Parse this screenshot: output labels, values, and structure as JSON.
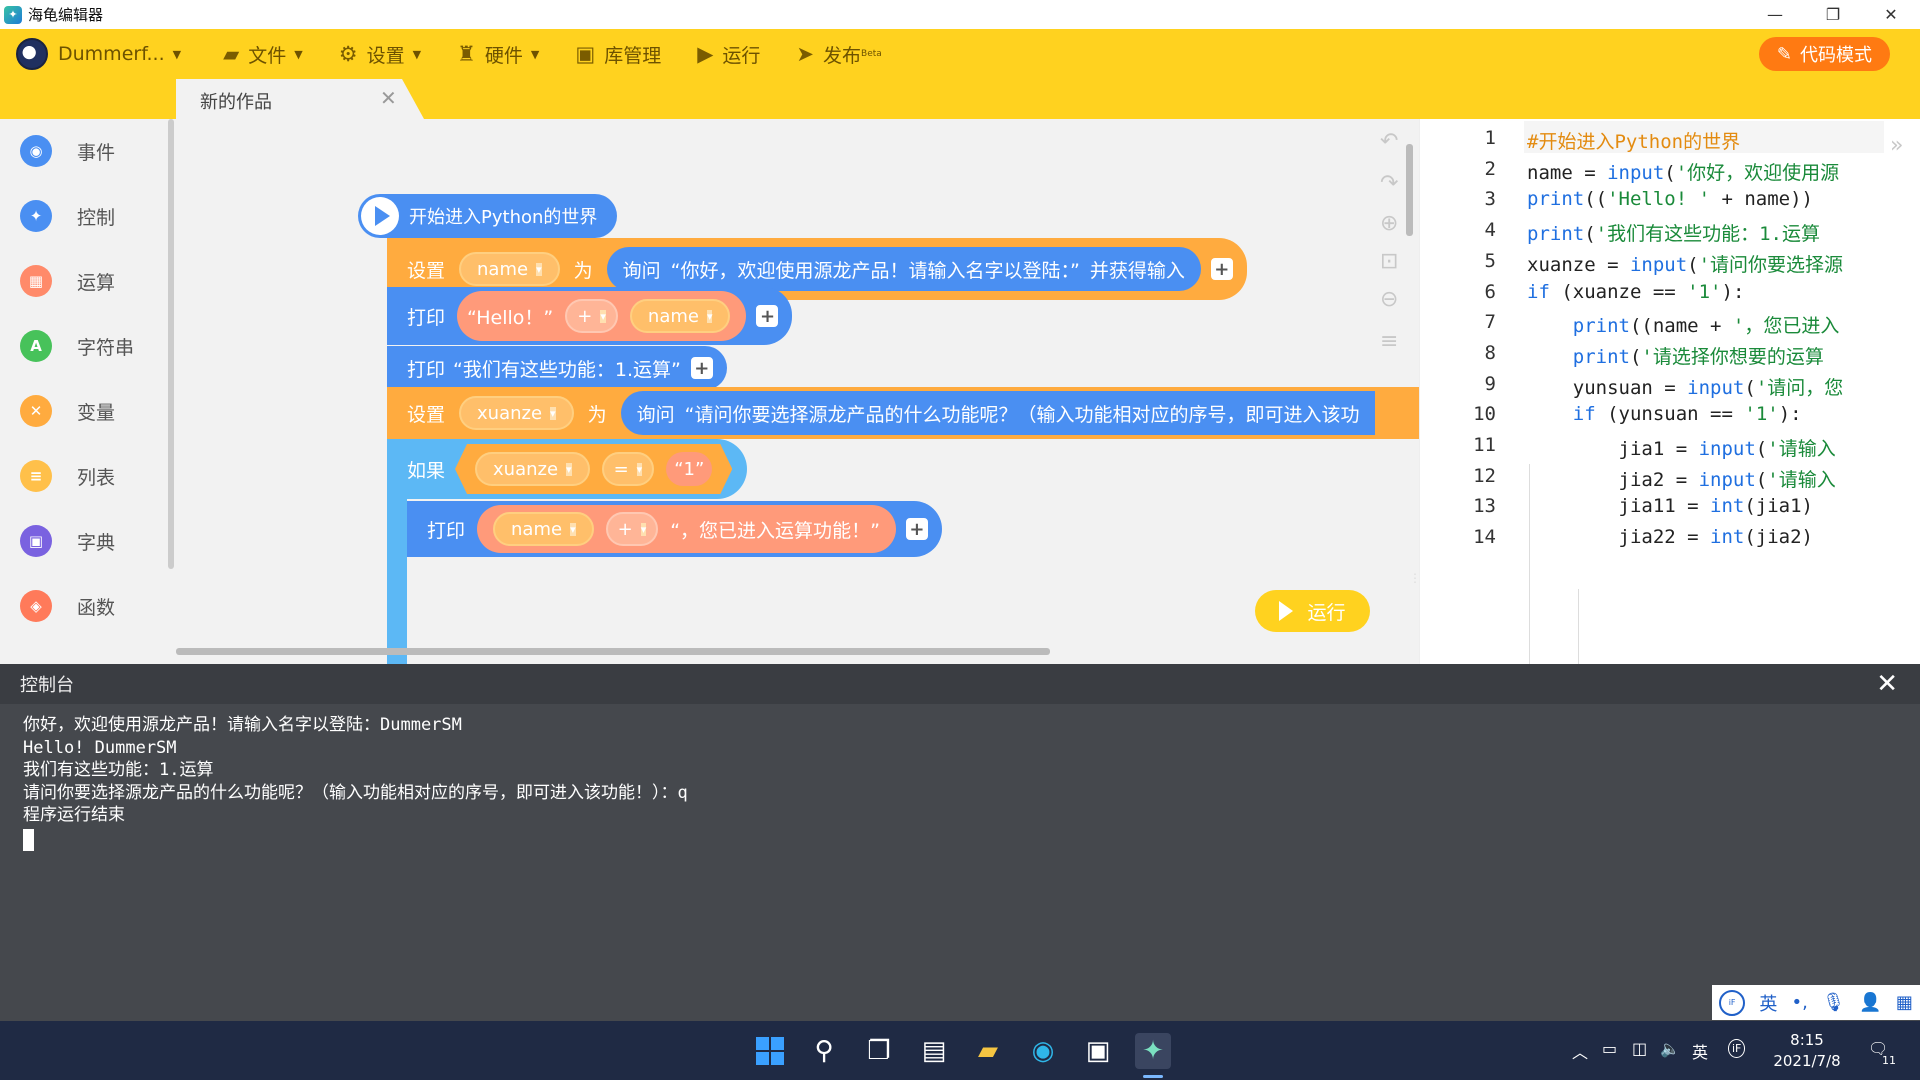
{
  "window": {
    "title": "海龟编辑器",
    "min": "—",
    "max": "❐",
    "close": "✕"
  },
  "toolbar": {
    "user": "Dummerf...",
    "file": "文件",
    "settings": "设置",
    "hardware": "硬件",
    "library": "库管理",
    "run": "运行",
    "publish": "发布",
    "publish_badge": "Beta",
    "code_mode": "代码模式"
  },
  "tab": {
    "label": "新的作品",
    "close": "✕"
  },
  "sidebar": {
    "items": [
      {
        "label": "事件",
        "color": "#4a8ff2",
        "glyph": "◉"
      },
      {
        "label": "控制",
        "color": "#4a8ff2",
        "glyph": "✦"
      },
      {
        "label": "运算",
        "color": "#ff8a6a",
        "glyph": "▦"
      },
      {
        "label": "字符串",
        "color": "#47c25a",
        "glyph": "A"
      },
      {
        "label": "变量",
        "color": "#ffab3f",
        "glyph": "✕"
      },
      {
        "label": "列表",
        "color": "#ffc04a",
        "glyph": "≡"
      },
      {
        "label": "字典",
        "color": "#7a62e0",
        "glyph": "▣"
      },
      {
        "label": "函数",
        "color": "#ff7a5a",
        "glyph": "◈"
      }
    ]
  },
  "blocks": {
    "hat": "开始进入Python的世界",
    "set": "设置",
    "to": "为",
    "ask": "询问",
    "ask1": "“你好，欢迎使用源龙产品！请输入名字以登陆：”",
    "ask_tail": "并获得输入",
    "var_name": "name",
    "print": "打印",
    "hello": "“Hello！”",
    "plus_op": "+",
    "print2": "“我们有这些功能：1.运算”",
    "var_xuanze": "xuanze",
    "ask2": "“请问你要选择源龙产品的什么功能呢？（输入功能相对应的序号，即可进入该功",
    "if": "如果",
    "eq_op": "=",
    "one": "“1”",
    "print3_text": "“，您已进入运算功能！”",
    "run": "运行"
  },
  "code": {
    "lines": [
      [
        {
          "t": "#开始进入Python的世界",
          "c": "cm"
        }
      ],
      [
        {
          "t": "name = "
        },
        {
          "t": "input",
          "c": "kw"
        },
        {
          "t": "("
        },
        {
          "t": "'你好，欢迎使用源",
          "c": "st"
        }
      ],
      [
        {
          "t": "print",
          "c": "kw"
        },
        {
          "t": "(("
        },
        {
          "t": "'Hello! '",
          "c": "st"
        },
        {
          "t": " + name))"
        }
      ],
      [
        {
          "t": "print",
          "c": "kw"
        },
        {
          "t": "("
        },
        {
          "t": "'我们有这些功能：1.运算",
          "c": "st"
        }
      ],
      [
        {
          "t": "xuanze = "
        },
        {
          "t": "input",
          "c": "kw"
        },
        {
          "t": "("
        },
        {
          "t": "'请问你要选择源",
          "c": "st"
        }
      ],
      [
        {
          "t": "if",
          "c": "kw"
        },
        {
          "t": " (xuanze == "
        },
        {
          "t": "'1'",
          "c": "st"
        },
        {
          "t": "):"
        }
      ],
      [
        {
          "t": "    "
        },
        {
          "t": "print",
          "c": "kw"
        },
        {
          "t": "((name + "
        },
        {
          "t": "'，您已进入",
          "c": "st"
        }
      ],
      [
        {
          "t": "    "
        },
        {
          "t": "print",
          "c": "kw"
        },
        {
          "t": "("
        },
        {
          "t": "'请选择你想要的运算",
          "c": "st"
        }
      ],
      [
        {
          "t": "    yunsuan = "
        },
        {
          "t": "input",
          "c": "kw"
        },
        {
          "t": "("
        },
        {
          "t": "'请问，您",
          "c": "st"
        }
      ],
      [
        {
          "t": "    "
        },
        {
          "t": "if",
          "c": "kw"
        },
        {
          "t": " (yunsuan == "
        },
        {
          "t": "'1'",
          "c": "st"
        },
        {
          "t": "):"
        }
      ],
      [
        {
          "t": "        jia1 = "
        },
        {
          "t": "input",
          "c": "kw"
        },
        {
          "t": "("
        },
        {
          "t": "'请输入",
          "c": "st"
        }
      ],
      [
        {
          "t": "        jia2 = "
        },
        {
          "t": "input",
          "c": "kw"
        },
        {
          "t": "("
        },
        {
          "t": "'请输入",
          "c": "st"
        }
      ],
      [
        {
          "t": "        jia11 = "
        },
        {
          "t": "int",
          "c": "kw"
        },
        {
          "t": "(jia1)"
        }
      ],
      [
        {
          "t": "        jia22 = "
        },
        {
          "t": "int",
          "c": "kw"
        },
        {
          "t": "(jia2)"
        }
      ]
    ],
    "numbers": [
      "1",
      "2",
      "3",
      "4",
      "5",
      "6",
      "7",
      "8",
      "9",
      "10",
      "11",
      "12",
      "13",
      "14"
    ]
  },
  "console": {
    "title": "控制台",
    "close": "✕",
    "lines": [
      "你好，欢迎使用源龙产品！请输入名字以登陆：DummerSM",
      "Hello! DummerSM",
      "我们有这些功能：1.运算",
      "请问你要选择源龙产品的什么功能呢？（输入功能相对应的序号，即可进入该功能！）：q",
      "程序运行结束"
    ]
  },
  "ime": {
    "lang": "英"
  },
  "taskbar": {
    "tray_lang": "英",
    "time": "8:15",
    "date": "2021/7/8",
    "notif": "11"
  }
}
